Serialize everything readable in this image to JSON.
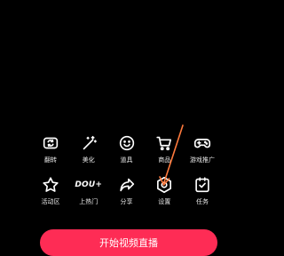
{
  "panel": {
    "rows": [
      [
        {
          "name": "flip-camera",
          "label": "翻转",
          "icon": "flip-camera-icon"
        },
        {
          "name": "beautify",
          "label": "美化",
          "icon": "magic-wand-icon"
        },
        {
          "name": "props",
          "label": "道具",
          "icon": "smiley-face-icon"
        },
        {
          "name": "shop",
          "label": "商品",
          "icon": "shopping-cart-icon"
        },
        {
          "name": "game-promo",
          "label": "游戏推广",
          "icon": "gamepad-icon"
        }
      ],
      [
        {
          "name": "activity-zone",
          "label": "活动区",
          "icon": "star-icon"
        },
        {
          "name": "trending",
          "label": "上热门",
          "icon": "douo-logo-icon",
          "logo_text": "DOU+"
        },
        {
          "name": "share",
          "label": "分享",
          "icon": "share-arrow-icon"
        },
        {
          "name": "settings",
          "label": "设置",
          "icon": "hexagon-settings-icon"
        },
        {
          "name": "tasks",
          "label": "任务",
          "icon": "task-checklist-icon"
        }
      ]
    ]
  },
  "start_button": {
    "label": "开始视频直播"
  },
  "colors": {
    "background": "#000000",
    "accent": "#fe2c55",
    "annotation_arrow": "#ff7a3d"
  }
}
